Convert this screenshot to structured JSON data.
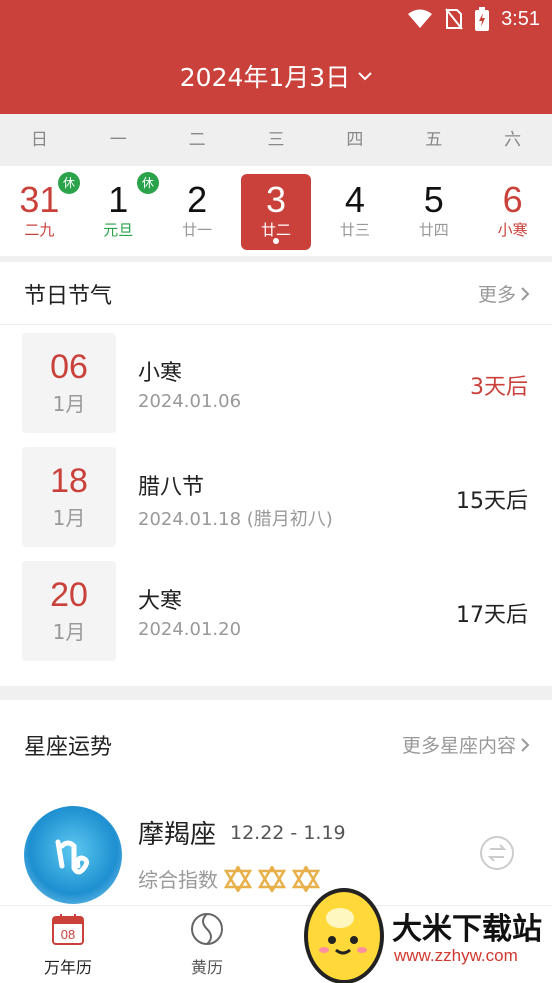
{
  "status_bar": {
    "time": "3:51"
  },
  "header": {
    "title": "2024年1月3日"
  },
  "weekdays": [
    "日",
    "一",
    "二",
    "三",
    "四",
    "五",
    "六"
  ],
  "dates": [
    {
      "day": "31",
      "lunar": "二九",
      "badge": "休"
    },
    {
      "day": "1",
      "lunar": "元旦",
      "badge": "休"
    },
    {
      "day": "2",
      "lunar": "廿一"
    },
    {
      "day": "3",
      "lunar": "廿二"
    },
    {
      "day": "4",
      "lunar": "廿三"
    },
    {
      "day": "5",
      "lunar": "廿四"
    },
    {
      "day": "6",
      "lunar": "小寒"
    }
  ],
  "festivals": {
    "title": "节日节气",
    "more": "更多",
    "items": [
      {
        "day": "06",
        "month": "1月",
        "name": "小寒",
        "date": "2024.01.06",
        "countdown": "3天后"
      },
      {
        "day": "18",
        "month": "1月",
        "name": "腊八节",
        "date": "2024.01.18 (腊月初八)",
        "countdown": "15天后"
      },
      {
        "day": "20",
        "month": "1月",
        "name": "大寒",
        "date": "2024.01.20",
        "countdown": "17天后"
      }
    ]
  },
  "constellation": {
    "title": "星座运势",
    "more": "更多星座内容",
    "name": "摩羯座",
    "range": "12.22 - 1.19",
    "index_label": "综合指数",
    "rating_stars_shown": 3
  },
  "bottom_nav": {
    "items": [
      {
        "label": "万年历",
        "icon_text": "08"
      },
      {
        "label": "黄历"
      }
    ]
  },
  "watermark": {
    "name": "大米下载站",
    "url": "www.zzhyw.com"
  },
  "colors": {
    "brand_red": "#c9413a",
    "holiday_green": "#2ba34a"
  }
}
